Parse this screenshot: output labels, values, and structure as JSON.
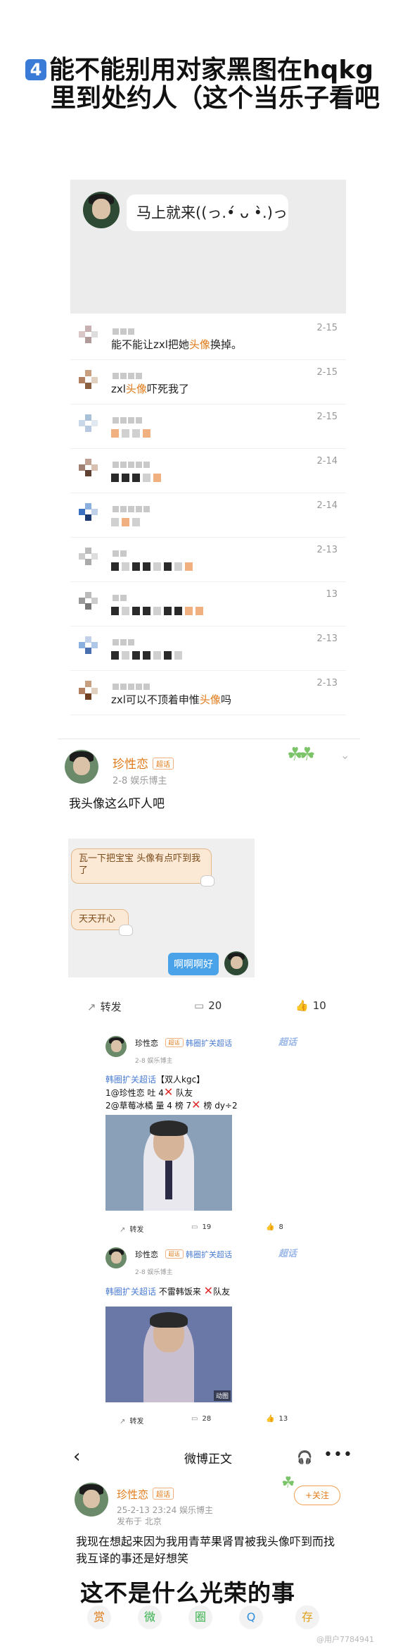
{
  "header": {
    "badge": "4",
    "line1": "能不能别用对家黑图在hqkg",
    "line2": "里到处约人（这个当乐子看吧"
  },
  "chat_preview": {
    "bubble": "马上就来((っ.•́ ᴗ •̀.)っ"
  },
  "comments": [
    {
      "text_a": "能不能让zxl把她",
      "highlight": "头像",
      "text_b": "换掉。",
      "date": "2-15"
    },
    {
      "text_a": "zxl",
      "highlight": "头像",
      "text_b": "吓死我了",
      "date": "2-15"
    },
    {
      "date": "2-15"
    },
    {
      "date": "2-14"
    },
    {
      "date": "2-14"
    },
    {
      "date": "2-13"
    },
    {
      "date": "13"
    },
    {
      "date": "2-13"
    },
    {
      "text_a": "zxl可以不顶着申惟",
      "highlight": "头像",
      "text_b": "吗",
      "date": "2-13"
    }
  ],
  "post1": {
    "name": "珍性恋",
    "level": "超话",
    "meta": "2-8  娱乐博主",
    "text": "我头像这么吓人吧",
    "chat": {
      "bubble1": "瓦一下把宝宝 头像有点吓到我了",
      "bubble2": "天天开心",
      "bubble_me": "啊啊啊好"
    },
    "actions": {
      "repost": "转发",
      "comments": "20",
      "likes": "10"
    }
  },
  "embed1": {
    "name": "珍性恋",
    "tag": "韩圈扩关超话",
    "chaohua": "超话",
    "meta": "2-8  娱乐博主",
    "line1_tag": "韩圈扩关超话",
    "line1_rest": "【双人kgc】",
    "line2_a": "1@珍性恋 吐 4",
    "line2_b": " 队友",
    "line3_a": "2@草莓冰橘 量 4 榜 7",
    "line3_b": " 榜 dy÷2",
    "actions": {
      "repost": "转发",
      "comments": "19",
      "likes": "8"
    }
  },
  "embed2": {
    "name": "珍性恋",
    "tag": "韩圈扩关超话",
    "chaohua": "超话",
    "meta": "2-8  娱乐博主",
    "line1_tag": "韩圈扩关超话",
    "line1_rest": " 不雷韩饭来 ",
    "line1_tail": "队友",
    "badge": "动图",
    "actions": {
      "repost": "转发",
      "comments": "28",
      "likes": "13"
    }
  },
  "detail": {
    "nav_title": "微博正文",
    "name": "珍性恋",
    "level": "超话",
    "meta": "25-2-13 23:24  娱乐博主",
    "location": "发布于 北京",
    "follow": "+关注",
    "text": "我现在想起来因为我用青苹果肾胃被我头像吓到而找我互译的事还是好想笑",
    "caption": "这不是什么光荣的事",
    "share_icons": [
      "赏",
      "微",
      "圈",
      "Q",
      "存"
    ]
  },
  "watermark": "@用户7784941"
}
